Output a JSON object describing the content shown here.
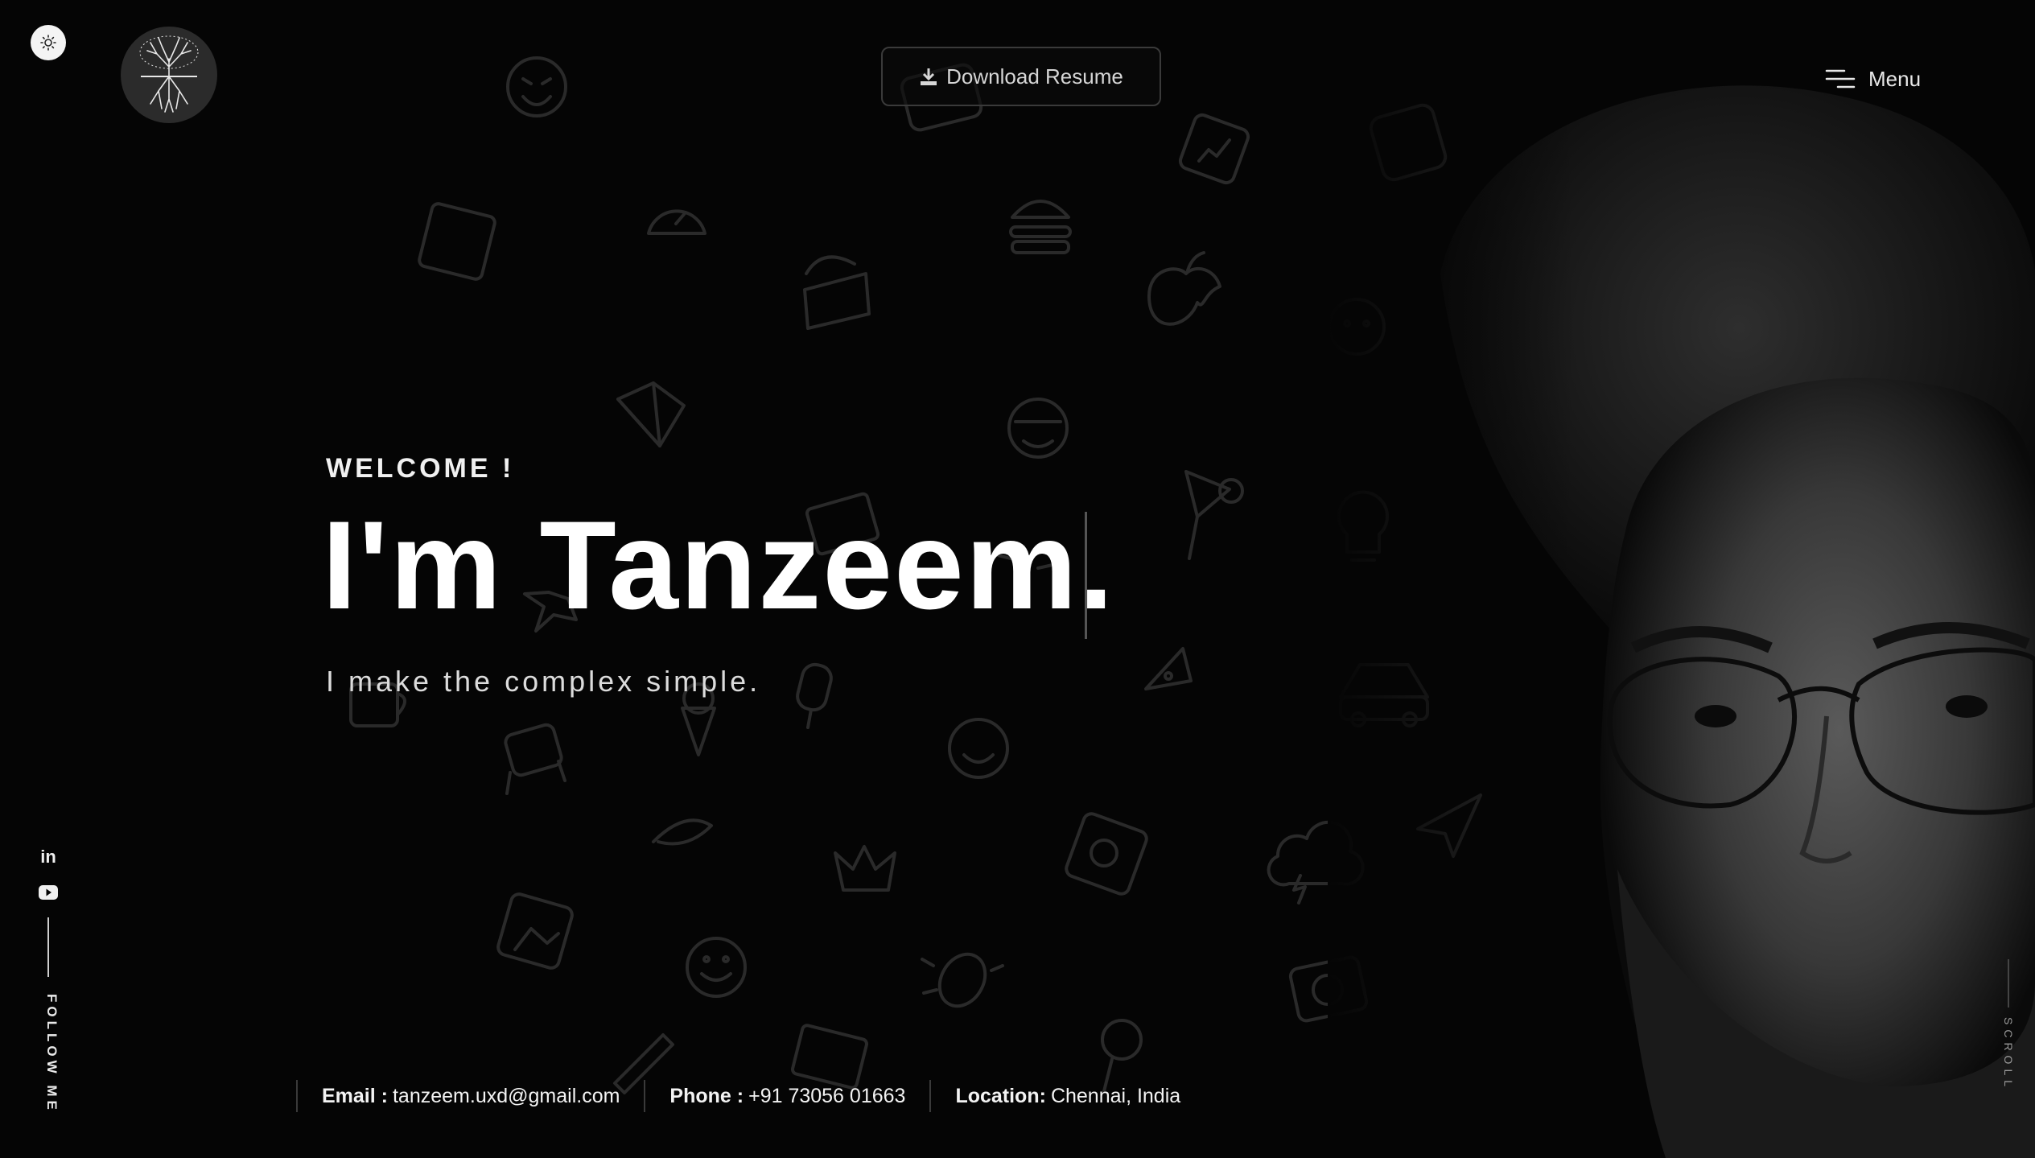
{
  "header": {
    "download_label": "Download Resume",
    "menu_label": "Menu"
  },
  "hero": {
    "welcome": "WELCOME !",
    "headline": "I'm Tanzeem.",
    "tagline": "I make the complex simple."
  },
  "social": {
    "items": [
      {
        "icon": "linkedin-icon",
        "label": "in"
      },
      {
        "icon": "youtube-icon"
      }
    ],
    "follow_label": "FOLLOW ME"
  },
  "contact": {
    "email_label": "Email :",
    "email": "tanzeem.uxd@gmail.com",
    "phone_label": "Phone :",
    "phone": "+91 73056 01663",
    "location_label": "Location:",
    "location": "Chennai, India"
  },
  "scroll_label": "SCROLL",
  "colors": {
    "background": "#050505",
    "text": "#ffffff",
    "muted": "#2a2a2a"
  }
}
